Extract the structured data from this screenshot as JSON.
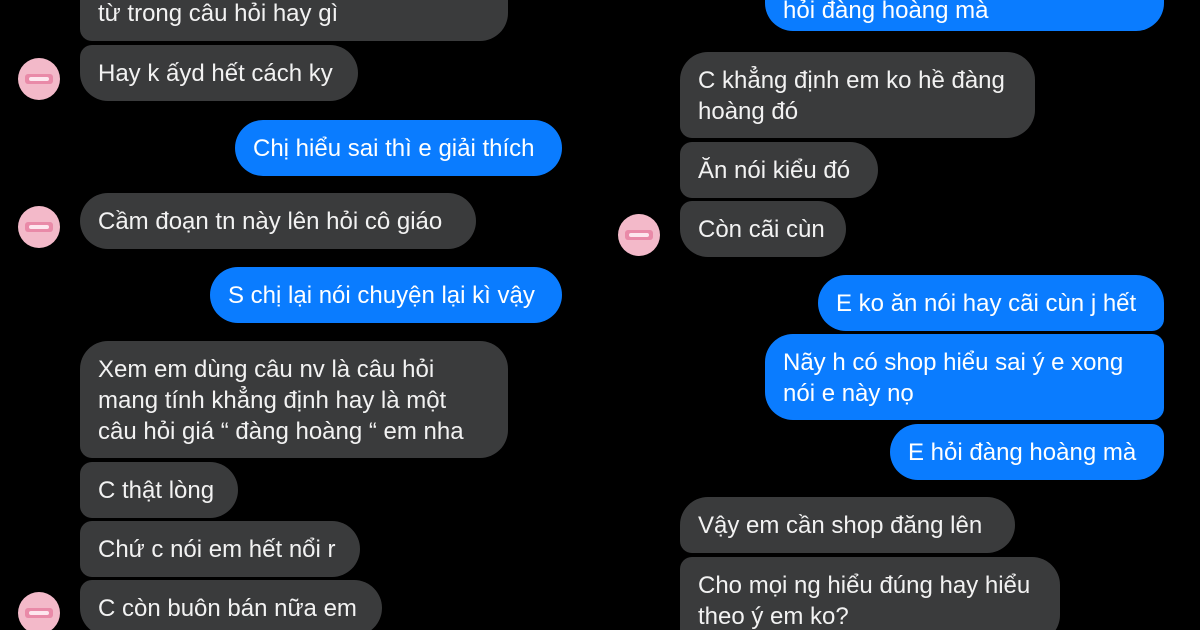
{
  "left_column": {
    "messages": [
      {
        "id": "l0",
        "dir": "in",
        "text": "từ trong câu hỏi hay gì"
      },
      {
        "id": "l1",
        "dir": "in",
        "text": "Hay k ấyd hết cách ky"
      },
      {
        "id": "l2",
        "dir": "out",
        "text": "Chị hiểu sai thì e giải thích"
      },
      {
        "id": "l3",
        "dir": "in",
        "text": "Cầm đoạn tn này lên hỏi cô giáo"
      },
      {
        "id": "l4",
        "dir": "out",
        "text": "S chị lại nói chuyện lại kì vậy"
      },
      {
        "id": "l5",
        "dir": "in",
        "lines": [
          "Xem em dùng câu nv là câu hỏi",
          "mang tính khẳng định hay là một",
          "câu hỏi giá “ đàng hoàng “ em nha"
        ]
      },
      {
        "id": "l6",
        "dir": "in",
        "text": "C thật lòng"
      },
      {
        "id": "l7",
        "dir": "in",
        "text": "Chứ c nói em hết nổi r"
      },
      {
        "id": "l8",
        "dir": "in",
        "text": "C còn buôn bán nữa em"
      }
    ]
  },
  "right_column": {
    "messages": [
      {
        "id": "r0",
        "dir": "out",
        "text": "hỏi đàng hoàng mà"
      },
      {
        "id": "r1",
        "dir": "in",
        "lines": [
          "C khẳng định em ko hề đàng",
          "hoàng đó"
        ]
      },
      {
        "id": "r2",
        "dir": "in",
        "text": "Ăn nói kiểu đó"
      },
      {
        "id": "r3",
        "dir": "in",
        "text": "Còn cãi cùn"
      },
      {
        "id": "r4",
        "dir": "out",
        "text": "E ko ăn nói hay cãi cùn j hết"
      },
      {
        "id": "r5",
        "dir": "out",
        "lines": [
          "Nãy h có shop hiểu sai ý e xong",
          "nói e này nọ"
        ]
      },
      {
        "id": "r6",
        "dir": "out",
        "text": "E hỏi đàng hoàng mà"
      },
      {
        "id": "r7",
        "dir": "in",
        "text": "Vậy em cần shop đăng lên"
      },
      {
        "id": "r8",
        "dir": "in",
        "lines": [
          "Cho mọi ng hiểu đúng hay hiểu",
          "theo ý em ko?"
        ]
      }
    ]
  },
  "colors": {
    "background": "#000000",
    "incoming_bubble": "#3a3b3c",
    "outgoing_bubble": "#0a7cff",
    "avatar": "#f3b9c9"
  },
  "icons": {
    "contact_avatar": "avatar-icon"
  }
}
